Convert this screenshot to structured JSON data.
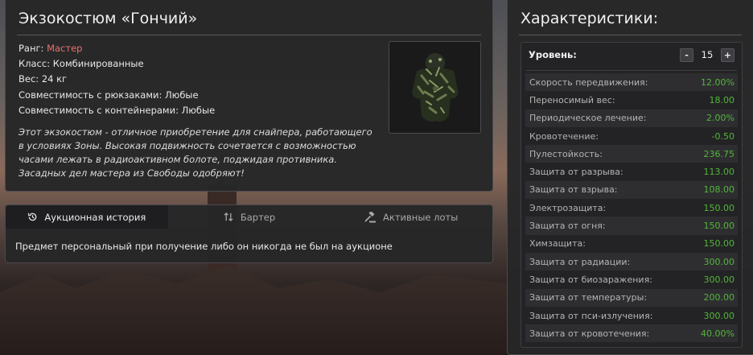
{
  "item": {
    "title": "Экзокостюм «Гончий»",
    "rank_label": "Ранг:",
    "rank_value": "Мастер",
    "class_text": "Класс: Комбинированные",
    "weight_text": "Вес: 24 кг",
    "backpack_text": "Совместимость с рюкзаками: Любые",
    "container_text": "Совместимость с контейнерами: Любые",
    "description": "Этот экзокостюм - отличное приобретение для снайпера, работающего в условиях Зоны. Высокая подвижность сочетается с возможностью часами лежать в радиоактивном болоте, поджидая противника. Засадных дел мастера из Свободы одобряют!",
    "image_icon": "ghillie-exosuit-icon"
  },
  "tabs": [
    {
      "label": "Аукционная история",
      "icon": "history-icon",
      "active": true
    },
    {
      "label": "Бартер",
      "icon": "swap-arrows-icon",
      "active": false
    },
    {
      "label": "Активные лоты",
      "icon": "gavel-icon",
      "active": false
    }
  ],
  "tab_content": "Предмет персональный при получение либо он никогда не был на аукционе",
  "stats": {
    "title": "Характеристики:",
    "level_label": "Уровень:",
    "level_value": "15",
    "minus_label": "-",
    "plus_label": "+",
    "rows": [
      {
        "name": "Скорость передвижения:",
        "value": "12.00%"
      },
      {
        "name": "Переносимый вес:",
        "value": "18.00"
      },
      {
        "name": "Периодическое лечение:",
        "value": "2.00%"
      },
      {
        "name": "Кровотечение:",
        "value": "-0.50"
      },
      {
        "name": "Пулестойкость:",
        "value": "236.75"
      },
      {
        "name": "Защита от разрыва:",
        "value": "113.00"
      },
      {
        "name": "Защита от взрыва:",
        "value": "108.00"
      },
      {
        "name": "Электрозащита:",
        "value": "150.00"
      },
      {
        "name": "Защита от огня:",
        "value": "150.00"
      },
      {
        "name": "Химзащита:",
        "value": "150.00"
      },
      {
        "name": "Защита от радиации:",
        "value": "300.00"
      },
      {
        "name": "Защита от биозаражения:",
        "value": "300.00"
      },
      {
        "name": "Защита от температуры:",
        "value": "200.00"
      },
      {
        "name": "Защита от пси-излучения:",
        "value": "300.00"
      },
      {
        "name": "Защита от кровотечения:",
        "value": "40.00%"
      }
    ]
  },
  "colors": {
    "rank": "#e8726c",
    "stat_value": "#53b53a"
  }
}
